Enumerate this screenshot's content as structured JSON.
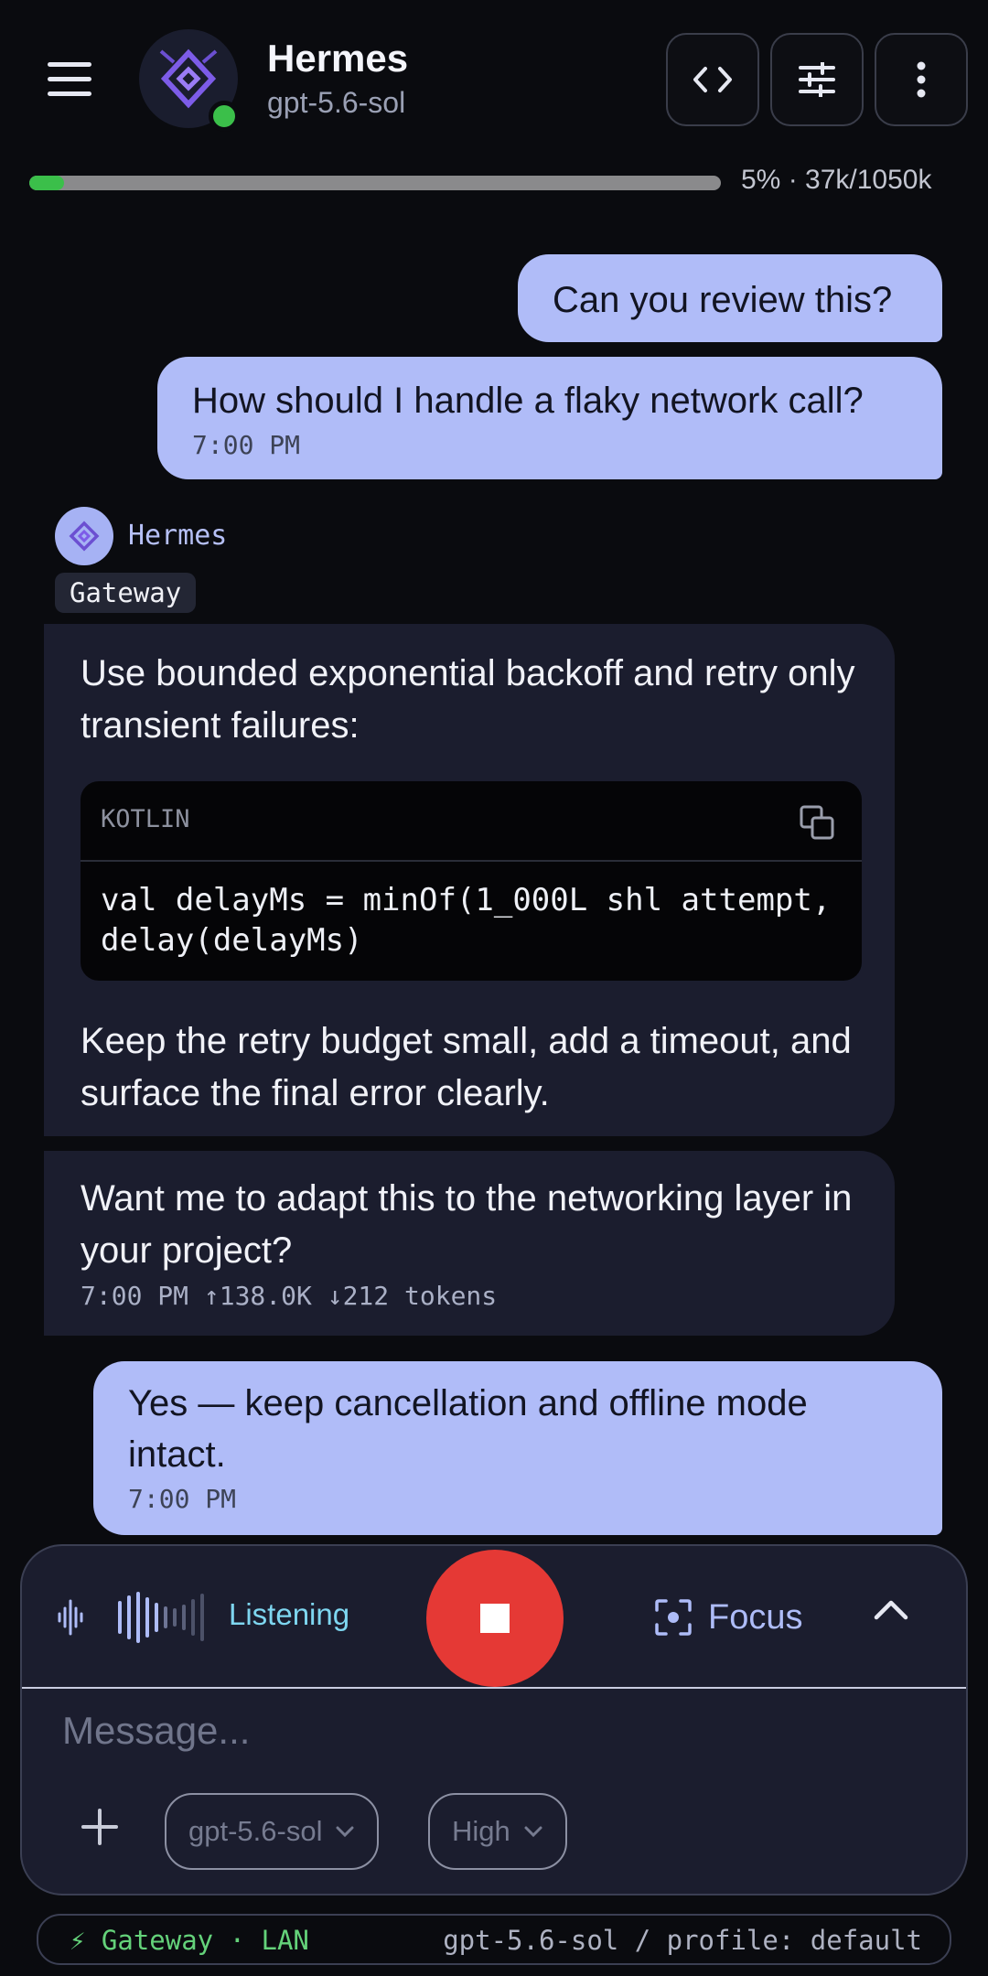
{
  "header": {
    "title": "Hermes",
    "subtitle": "gpt-5.6-sol",
    "status": "online"
  },
  "context": {
    "percent": 5,
    "label": "5% · 37k/1050k"
  },
  "messages": {
    "user1": "Can you review this?",
    "user2": {
      "text": "How should I handle a flaky network call?",
      "time": "7:00 PM"
    },
    "assistant": {
      "name": "Hermes",
      "tag": "Gateway",
      "intro": "Use bounded exponential backoff and retry only transient failures:",
      "code_lang": "KOTLIN",
      "code": "val delayMs = minOf(1_000L shl attempt,\ndelay(delayMs)",
      "outro": "Keep the retry budget small, add a timeout, and surface the final error clearly.",
      "followup": "Want me to adapt this to the networking layer in your project?",
      "meta": "7:00 PM ↑138.0K ↓212 tokens"
    },
    "user3": {
      "text": "Yes — keep cancellation and offline mode intact.",
      "time": "7:00 PM"
    }
  },
  "composer": {
    "listening_label": "Listening",
    "focus_label": "Focus",
    "placeholder": "Message...",
    "model_pill": "gpt-5.6-sol",
    "effort_pill": "High"
  },
  "footer": {
    "left": "⚡ Gateway  ·  LAN",
    "right": "gpt-5.6-sol / profile: default"
  },
  "colors": {
    "accent": "#b0bcf8",
    "online": "#3bbf4a",
    "stop": "#e53935",
    "listening": "#7ed6f0"
  }
}
